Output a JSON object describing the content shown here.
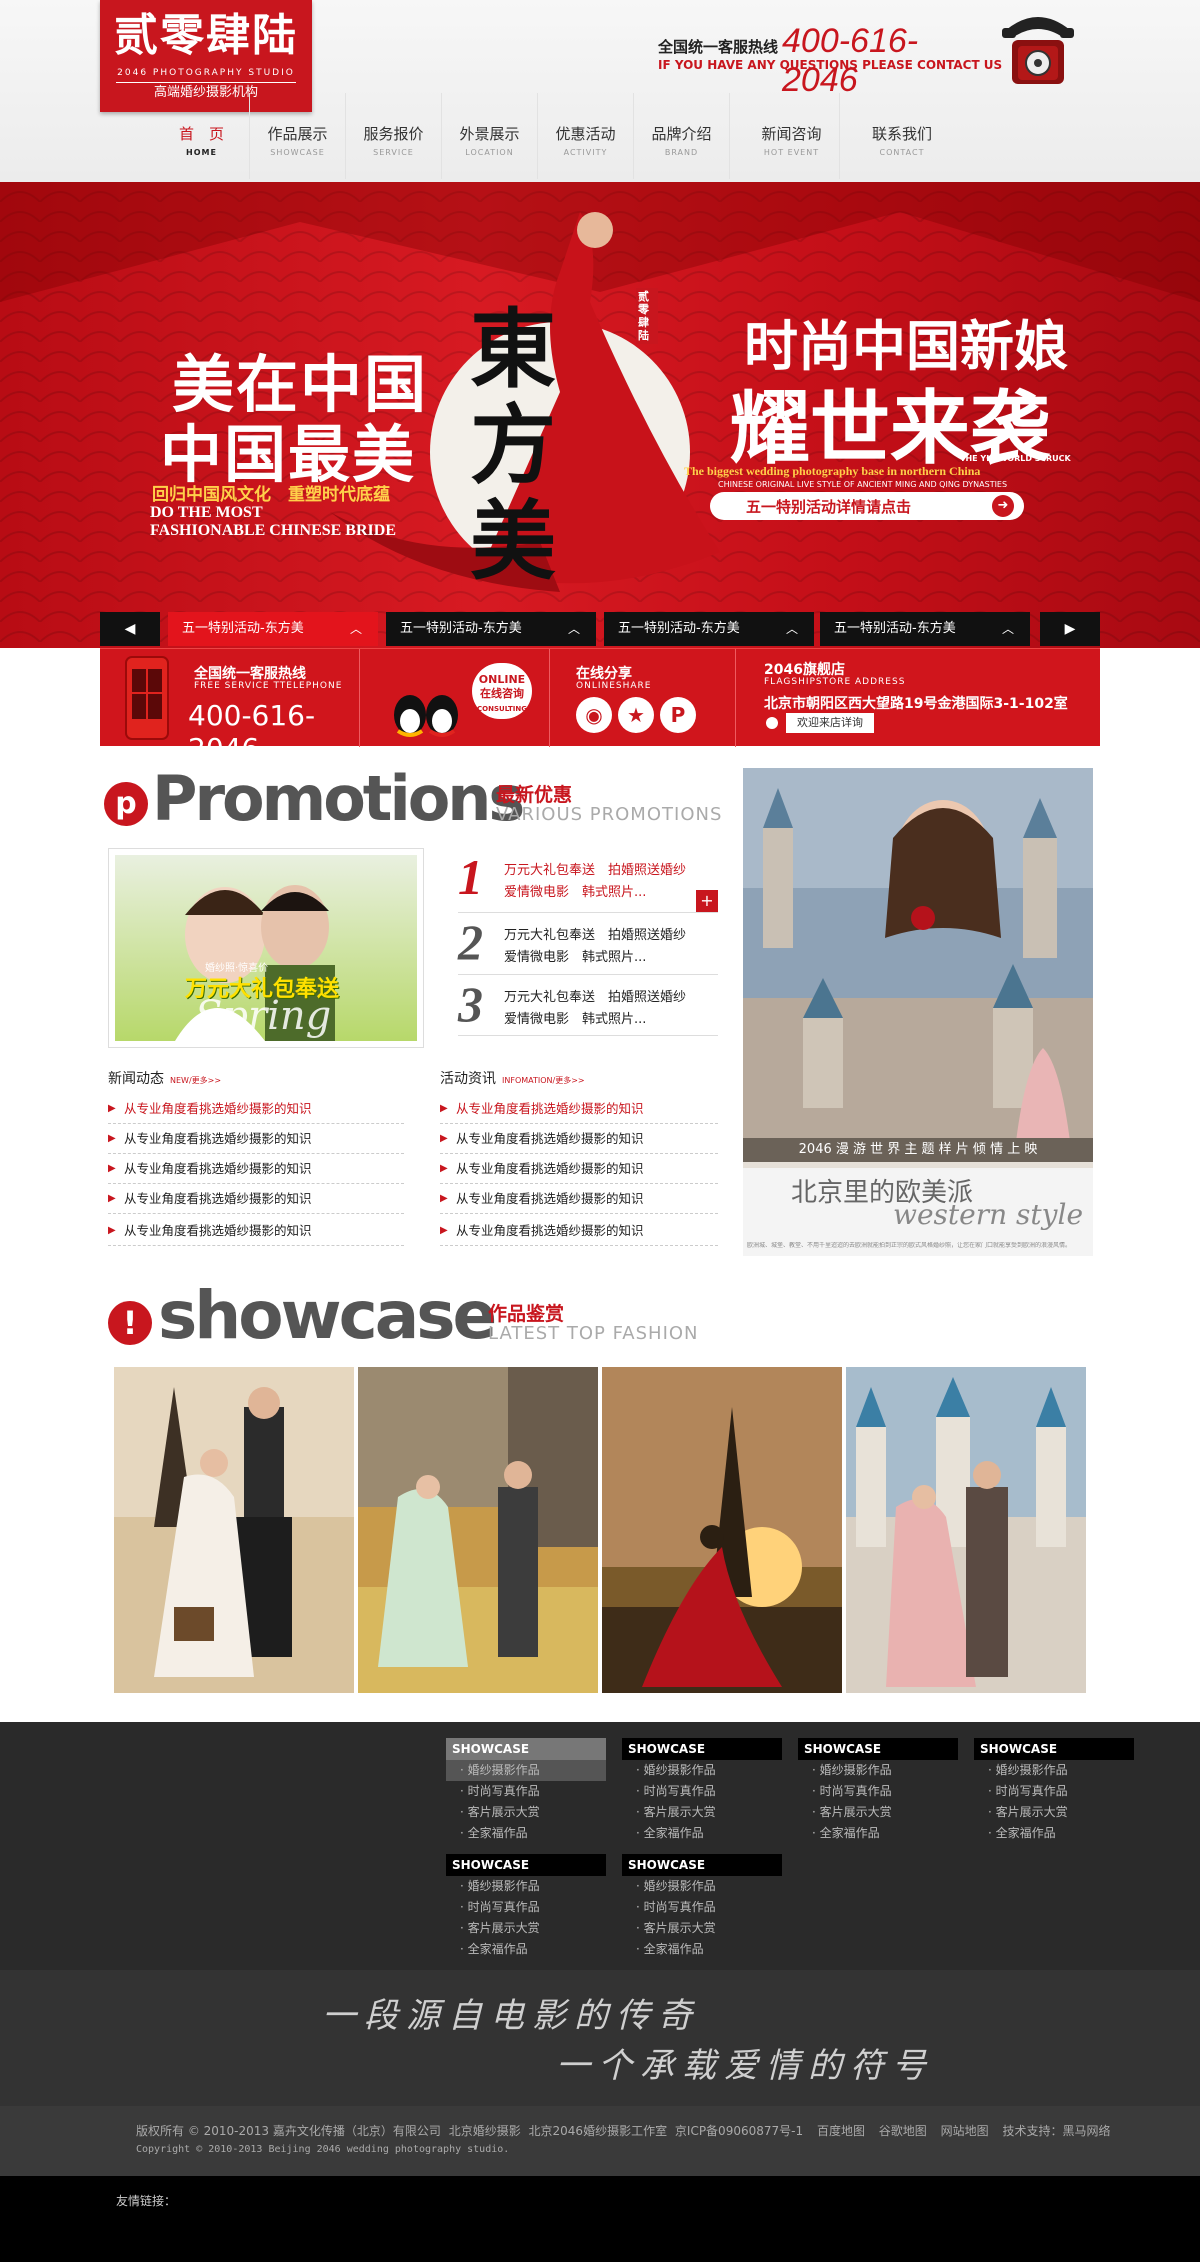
{
  "header": {
    "logo": {
      "title": "贰零肆陆",
      "en": "2046 PHOTOGRAPHY STUDIO",
      "sub": "高端婚纱摄影机构"
    },
    "hotline": {
      "label": "全国统一客服热线",
      "number": "400-616-2046",
      "en": "IF YOU HAVE ANY QUESTIONS PLEASE CONTACT US"
    },
    "nav": [
      {
        "cn": "首　页",
        "en": "HOME"
      },
      {
        "cn": "作品展示",
        "en": "SHOWCASE"
      },
      {
        "cn": "服务报价",
        "en": "SERVICE"
      },
      {
        "cn": "外景展示",
        "en": "LOCATION"
      },
      {
        "cn": "优惠活动",
        "en": "ACTIVITY"
      },
      {
        "cn": "品牌介绍",
        "en": "BRAND"
      },
      {
        "cn": "新闻咨询",
        "en": "HOT EVENT"
      },
      {
        "cn": "联系我们",
        "en": "CONTACT"
      }
    ]
  },
  "banner": {
    "left1": "美在中国",
    "left2": "中国最美",
    "left3": "回归中国风文化　重塑时代底蕴",
    "left4": "DO THE MOST",
    "left5": "FASHIONABLE CHINESE BRIDE",
    "center": "東方美",
    "seal": "贰零肆陆",
    "right1": "时尚中国新娘",
    "right2": "耀世来袭",
    "right3": "THE YIU WORLD STRUCK",
    "right4": "The biggest wedding photography base in northern China",
    "right5": "CHINESE ORIGINAL LIVE STYLE OF ANCIENT MING AND QING DYNASTIES",
    "button": "五一特别活动详情请点击"
  },
  "tabs": [
    "五一特别活动-东方美",
    "五一特别活动-东方美",
    "五一特别活动-东方美",
    "五一特别活动-东方美"
  ],
  "info": {
    "hotline_label": "全国统一客服热线",
    "hotline_en": "FREE SERVICE TTELEPHONE",
    "hotline_number": "400-616-2046",
    "online_cn": "ONLINE 在线咨询",
    "online_en": "CONSULTING",
    "share_cn": "在线分享",
    "share_en": "ONLINESHARE",
    "store_title": "2046旗舰店",
    "store_en": "FLAGSHIPSTORE ADDRESS",
    "store_addr": "北京市朝阳区西大望路19号金港国际3-1-102室",
    "store_btn": "欢迎来店详询"
  },
  "promo": {
    "big": "Promotions",
    "cn": "最新优惠",
    "en": "VARIOUS PROMOTIONS",
    "card_text": "万元大礼包奉送",
    "card_sub": "婚纱照·惊喜价",
    "card_script": "Spring",
    "items": [
      {
        "n": "1",
        "t": "万元大礼包奉送　拍婚照送婚纱　爱情微电影　韩式照片..."
      },
      {
        "n": "2",
        "t": "万元大礼包奉送　拍婚照送婚纱　爱情微电影　韩式照片..."
      },
      {
        "n": "3",
        "t": "万元大礼包奉送　拍婚照送婚纱　爱情微电影　韩式照片..."
      }
    ],
    "news_head": "新闻动态",
    "news_more": "NEW/更多>>",
    "act_head": "活动资讯",
    "act_more": "INFOMATION/更多>>",
    "news": [
      "从专业角度看挑选婚纱摄影的知识",
      "从专业角度看挑选婚纱摄影的知识",
      "从专业角度看挑选婚纱摄影的知识",
      "从专业角度看挑选婚纱摄影的知识",
      "从专业角度看挑选婚纱摄影的知识"
    ],
    "acts": [
      "从专业角度看挑选婚纱摄影的知识",
      "从专业角度看挑选婚纱摄影的知识",
      "从专业角度看挑选婚纱摄影的知识",
      "从专业角度看挑选婚纱摄影的知识",
      "从专业角度看挑选婚纱摄影的知识"
    ],
    "side_caption": "2046 漫 游 世 界 主 题 样 片 倾 情 上 映",
    "side_title": "北京里的欧美派",
    "side_script": "western style",
    "side_small": "欧洲城、城堡、教堂、不用千里迢迢的去欧洲就能拍到正宗的欧式风格婚纱照，让您在家门口就能享受到欧洲的浪漫风情。"
  },
  "showcase": {
    "big": "showcase",
    "cn": "作品鉴赏",
    "en": "LATEST TOP FASHION"
  },
  "footer": {
    "cols": [
      {
        "h": "SHOWCASE",
        "items": [
          "婚纱摄影作品",
          "时尚写真作品",
          "客片展示大赏",
          "全家福作品"
        ]
      },
      {
        "h": "SHOWCASE",
        "items": [
          "婚纱摄影作品",
          "时尚写真作品",
          "客片展示大赏",
          "全家福作品"
        ]
      },
      {
        "h": "SHOWCASE",
        "items": [
          "婚纱摄影作品",
          "时尚写真作品",
          "客片展示大赏",
          "全家福作品"
        ]
      },
      {
        "h": "SHOWCASE",
        "items": [
          "婚纱摄影作品",
          "时尚写真作品",
          "客片展示大赏",
          "全家福作品"
        ]
      },
      {
        "h": "SHOWCASE",
        "items": [
          "婚纱摄影作品",
          "时尚写真作品",
          "客片展示大赏",
          "全家福作品"
        ]
      },
      {
        "h": "SHOWCASE",
        "items": [
          "婚纱摄影作品",
          "时尚写真作品",
          "客片展示大赏",
          "全家福作品"
        ]
      }
    ],
    "slogan1": "一段源自电影的传奇",
    "slogan2": "一个承载爱情的符号",
    "copy_cn": "版权所有 © 2010-2013 嘉卉文化传播（北京）有限公司",
    "copy_links": [
      "北京婚纱摄影",
      "北京2046婚纱摄影工作室",
      "京ICP备09060877号-1",
      "百度地图",
      "谷歌地图",
      "网站地图",
      "技术支持：黑马网络"
    ],
    "copy_en": "Copyright © 2010-2013 Beijing 2046 wedding photography studio.",
    "friend_links": "友情链接："
  },
  "colors": {
    "brand_red": "#c8161e",
    "dark": "#2a2a2a"
  }
}
